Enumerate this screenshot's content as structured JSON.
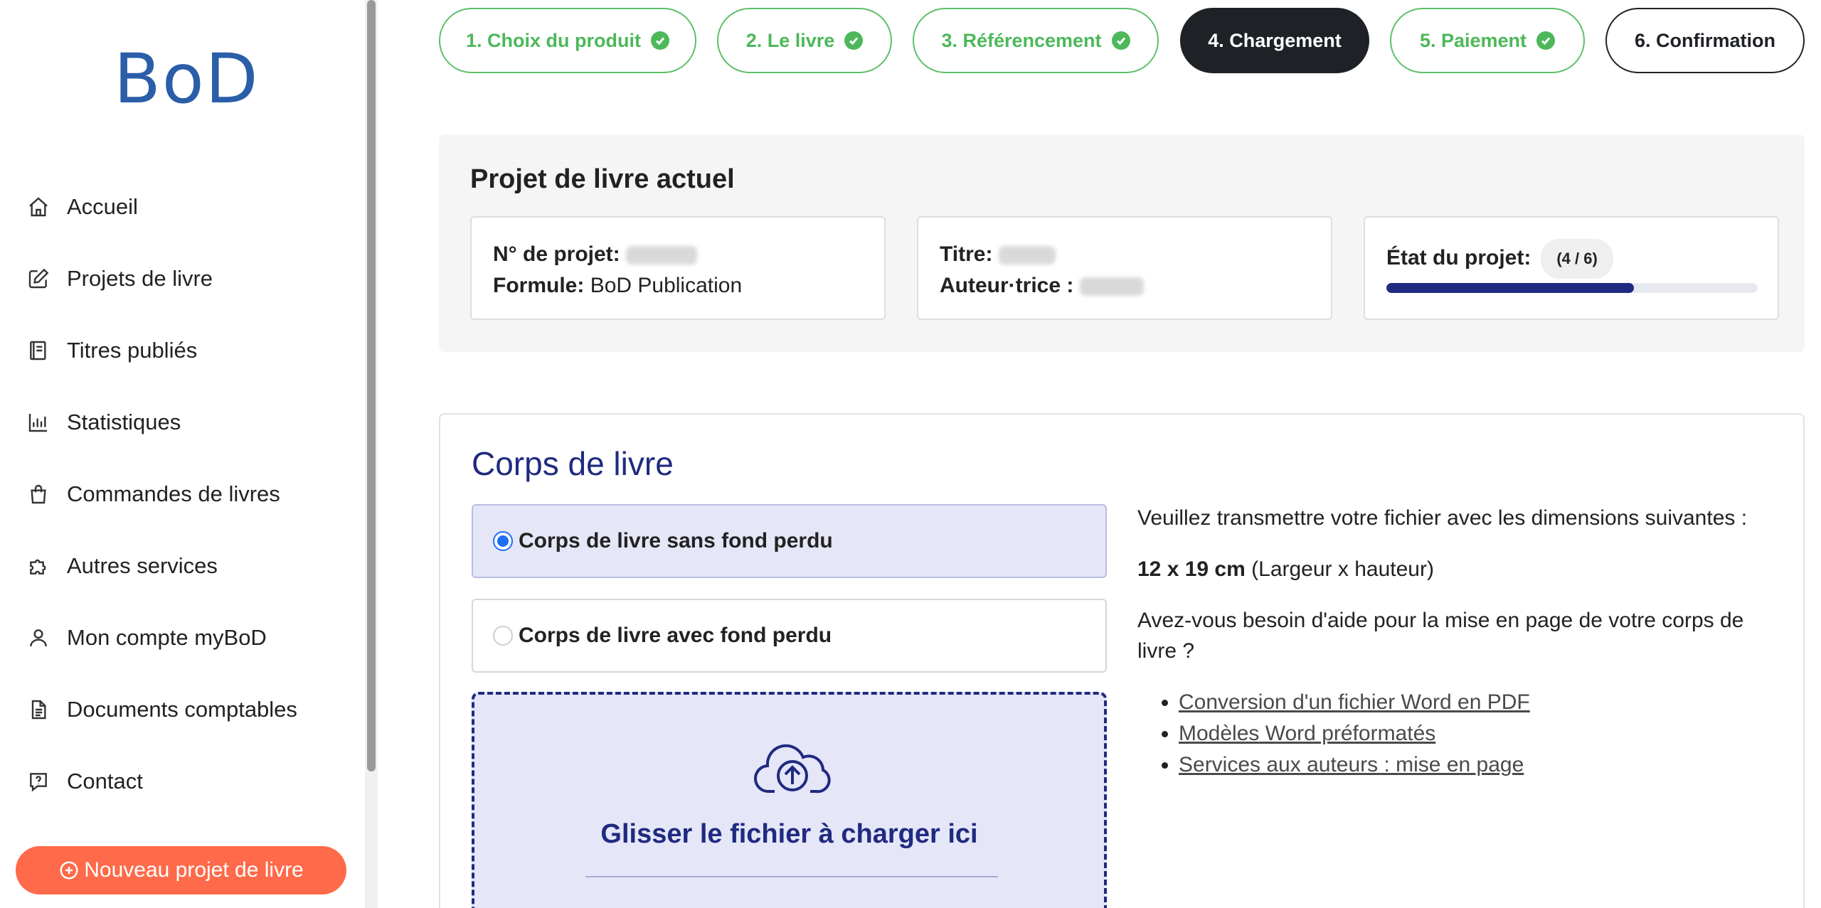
{
  "brand": {
    "logo": "BoD"
  },
  "sidebar": {
    "items": [
      {
        "label": "Accueil",
        "icon": "home-icon"
      },
      {
        "label": "Projets de livre",
        "icon": "edit-icon"
      },
      {
        "label": "Titres publiés",
        "icon": "book-icon"
      },
      {
        "label": "Statistiques",
        "icon": "bar-chart-icon"
      },
      {
        "label": "Commandes de livres",
        "icon": "shopping-bag-icon"
      },
      {
        "label": "Autres services",
        "icon": "puzzle-icon"
      },
      {
        "label": "Mon compte myBoD",
        "icon": "user-icon"
      },
      {
        "label": "Documents comptables",
        "icon": "document-icon"
      },
      {
        "label": "Contact",
        "icon": "help-chat-icon"
      }
    ],
    "new_project_label": "Nouveau projet de livre"
  },
  "steps": [
    {
      "label": "1. Choix du produit",
      "state": "done"
    },
    {
      "label": "2. Le livre",
      "state": "done"
    },
    {
      "label": "3. Référencement",
      "state": "done"
    },
    {
      "label": "4. Chargement",
      "state": "active"
    },
    {
      "label": "5. Paiement",
      "state": "done"
    },
    {
      "label": "6. Confirmation",
      "state": "todo"
    }
  ],
  "project": {
    "title": "Projet de livre actuel",
    "number_label": "N° de projet:",
    "formula_label": "Formule:",
    "formula_value": "BoD Publication",
    "title_label": "Titre:",
    "author_label": "Auteur·trice :",
    "status_label": "État du projet:",
    "status_badge": "(4 / 6)",
    "progress_fraction": 0.667
  },
  "book_body": {
    "title": "Corps de livre",
    "options": [
      {
        "label": "Corps de livre sans fond perdu",
        "selected": true
      },
      {
        "label": "Corps de livre avec fond perdu",
        "selected": false
      }
    ],
    "dropzone_text": "Glisser le fichier à charger ici",
    "instructions": "Veuillez transmettre votre fichier avec les dimensions suivantes :",
    "dimensions_bold": "12 x 19 cm",
    "dimensions_note": "(Largeur x hauteur)",
    "help_question": "Avez-vous besoin d'aide pour la mise en page de votre corps de livre ?",
    "links": [
      "Conversion d'un fichier Word en PDF",
      "Modèles Word préformatés",
      "Services aux auteurs : mise en page"
    ]
  },
  "colors": {
    "accent_navy": "#1f2a80",
    "success_green": "#4cb85a",
    "cta_orange": "#ff6a4a",
    "logo_blue": "#2a5ea8"
  }
}
